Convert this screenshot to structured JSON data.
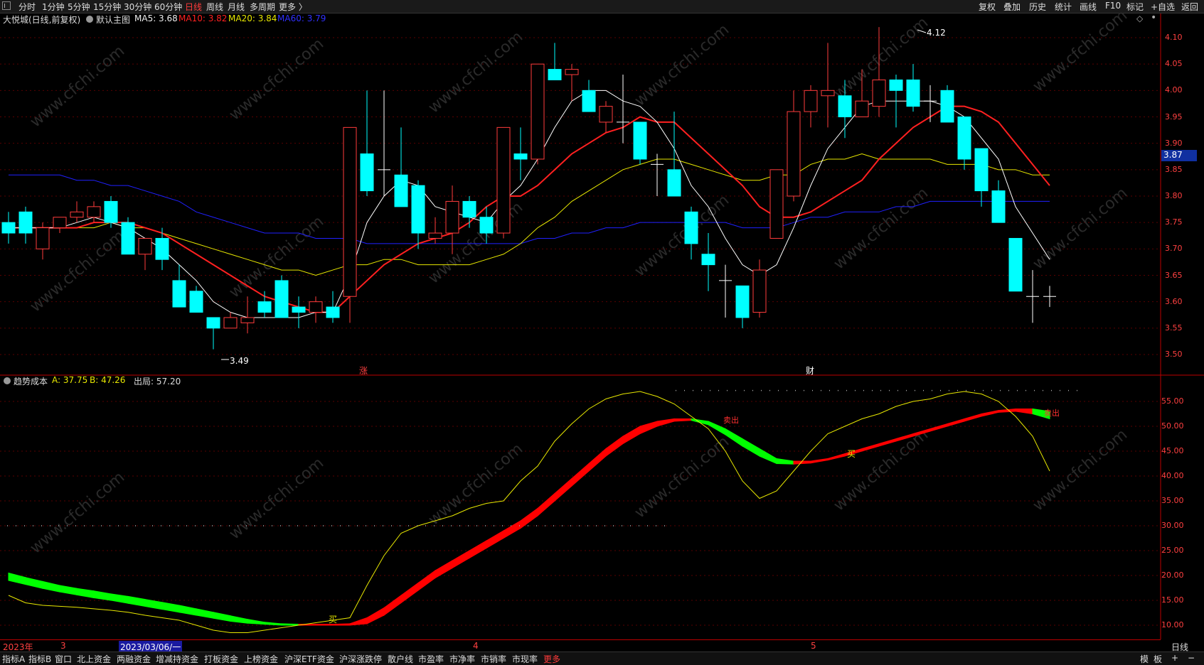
{
  "top_tabs": [
    "分时",
    "1分钟",
    "5分钟",
    "15分钟",
    "30分钟",
    "60分钟",
    "日线",
    "周线",
    "月线",
    "多周期",
    "更多 〉"
  ],
  "active_tab": "日线",
  "right_buttons": [
    "复权",
    "叠加",
    "历史",
    "统计",
    "画线",
    "F10",
    "标记",
    "+自选",
    "返回"
  ],
  "info": {
    "stock_name": "大悦城(日线,前复权)",
    "main_chart_label": "默认主图",
    "ma5": "MA5: 3.68",
    "ma10": "MA10: 3.82",
    "ma20": "MA20: 3.84",
    "ma60": "MA60: 3.79"
  },
  "indicator_info": {
    "name": "趋势成本",
    "a": "A: 37.75",
    "b": "B: 47.26",
    "out": "出局: 57.20"
  },
  "price_axis": [
    "4.10",
    "4.05",
    "4.00",
    "3.95",
    "3.90",
    "3.85",
    "3.80",
    "3.75",
    "3.70",
    "3.65",
    "3.60",
    "3.55",
    "3.50"
  ],
  "current_price": "3.87",
  "indicator_axis": [
    "55.00",
    "50.00",
    "45.00",
    "40.00",
    "35.00",
    "30.00",
    "25.00",
    "20.00",
    "15.00",
    "10.00"
  ],
  "annotations": {
    "high": "4.12",
    "low": "3.49",
    "marker_zhang": "涨",
    "marker_cai": "财",
    "buy": "买",
    "sell": "卖出"
  },
  "dates": [
    "2023年",
    "3",
    "2023/03/06/一",
    "4",
    "5"
  ],
  "period_label": "日线",
  "bottom_tabs": [
    "指标A",
    "指标B",
    "窗口",
    "北上资金",
    "两融资金",
    "增减持资金",
    "打板资金",
    "上榜资金",
    "沪深ETF资金",
    "沪深涨跌停",
    "散户线",
    "市盈率",
    "市净率",
    "市销率",
    "市现率",
    "更多"
  ],
  "bottom_right": [
    "模",
    "板",
    "+",
    "−"
  ],
  "watermark": "www.cfchi.com",
  "colors": {
    "up": "#ff3b3b",
    "down": "#00ffff",
    "ma5": "#ffffff",
    "ma10": "#ff2020",
    "ma20": "#e8e800",
    "ma60": "#2020ff",
    "band_up": "#ff0000",
    "band_down": "#00ff00"
  }
}
